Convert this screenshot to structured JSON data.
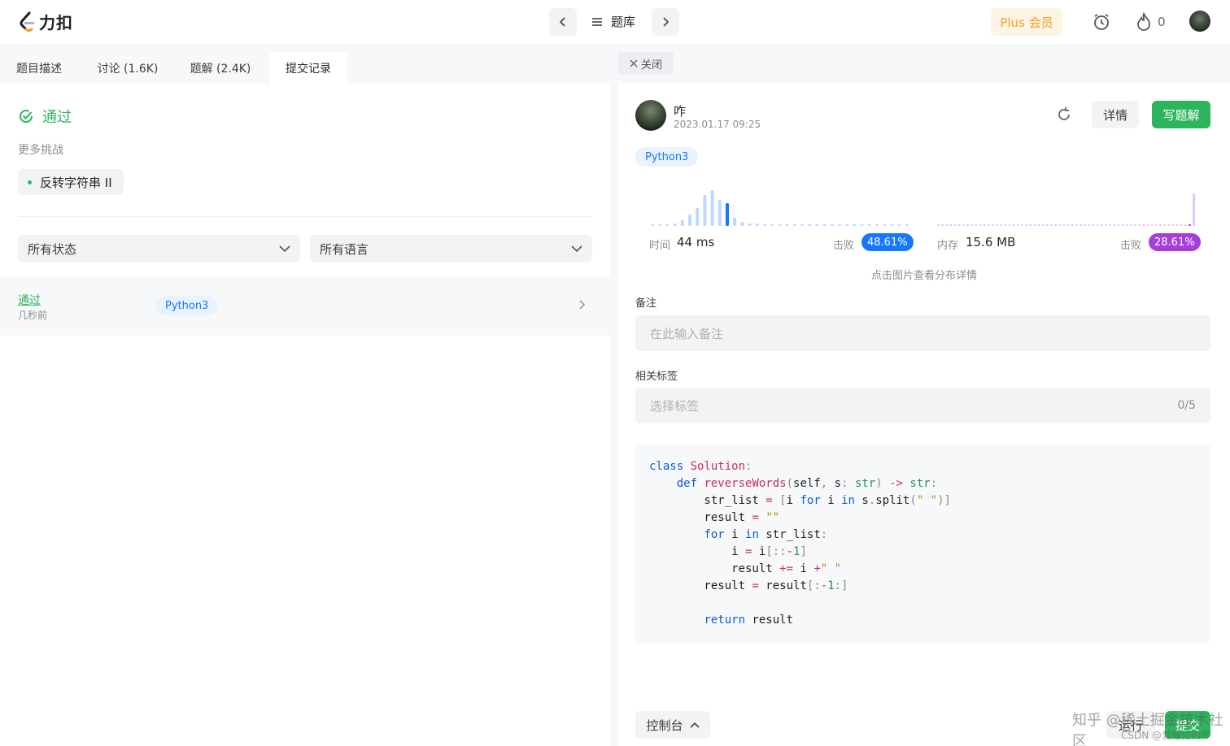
{
  "app": {
    "logo_text": "力扣"
  },
  "topnav": {
    "problem_list_label": "题库",
    "plus_label": "Plus 会员",
    "streak_count": "0"
  },
  "left": {
    "tabs": [
      {
        "label": "题目描述"
      },
      {
        "label": "讨论 (1.6K)"
      },
      {
        "label": "题解 (2.4K)"
      },
      {
        "label": "提交记录"
      }
    ],
    "status": "通过",
    "more_challenges_label": "更多挑战",
    "challenge_item": "反转字符串 II",
    "filter_status": "所有状态",
    "filter_language": "所有语言",
    "submissions": [
      {
        "status": "通过",
        "time": "几秒前",
        "language": "Python3"
      }
    ]
  },
  "right": {
    "close_label": "关闭",
    "author": {
      "name": "咋",
      "date": "2023.01.17 09:25"
    },
    "detail_label": "详情",
    "write_solution_label": "写题解",
    "language": "Python3",
    "runtime": {
      "label": "时间",
      "value": "44 ms",
      "beat_label": "击败",
      "beat": "48.61%",
      "color": "#1677ff"
    },
    "memory": {
      "label": "内存",
      "value": "15.6 MB",
      "beat_label": "击败",
      "beat": "28.61%",
      "color": "#a63fd9"
    },
    "chart_hint": "点击图片查看分布详情",
    "note_label": "备注",
    "note_placeholder": "在此输入备注",
    "tags_label": "相关标签",
    "tags_placeholder": "选择标签",
    "tags_count": "0/5",
    "console_label": "控制台",
    "run_label": "运行",
    "submit_label": "提交"
  },
  "watermark": {
    "line1": "知乎 @稀土掘金技术社区",
    "line2": "CSDN @爱睡觉的咋"
  },
  "colors": {
    "accent_green": "#2db55d",
    "accent_blue": "#1677ff",
    "accent_purple": "#a63fd9",
    "plus_orange": "#f0a020"
  }
}
